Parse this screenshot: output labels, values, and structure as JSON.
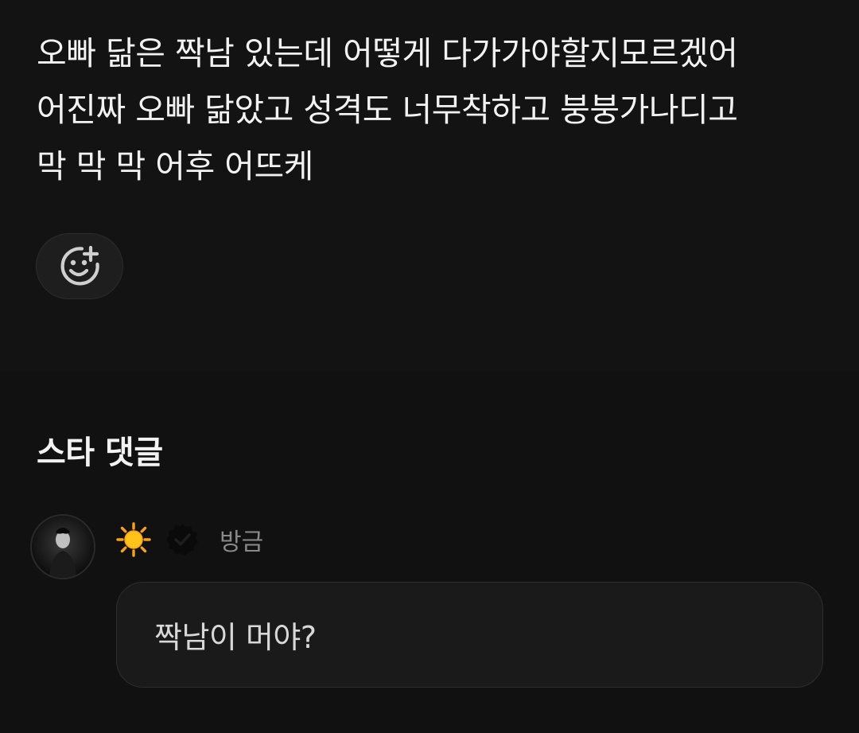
{
  "post": {
    "lines": [
      "오빠 닮은 짝남 있는데 어떻게 다가가야할지모르겠어",
      "어진짜 오빠 닮았고 성격도 너무착하고 붕붕가나디고",
      "막 막 막 어후 어뜨케"
    ],
    "reaction_icon": "add-reaction-smiley-icon"
  },
  "comments_section": {
    "title": "스타 댓글",
    "comments": [
      {
        "badge_icon": "sun-emoji-icon",
        "verified_icon": "verified-check-icon",
        "time": "방금",
        "text": "짝남이 머야?"
      }
    ]
  },
  "colors": {
    "background": "#131313",
    "text": "#f2f2f2",
    "muted": "#8a8a8a",
    "bubble": "#1a1a1a"
  }
}
